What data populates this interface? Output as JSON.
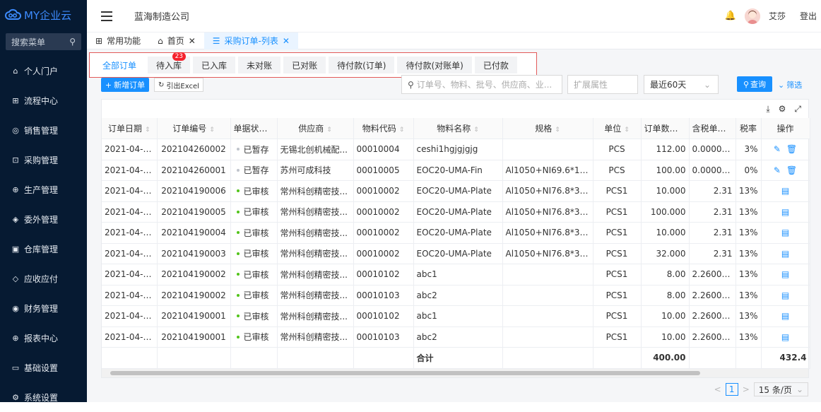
{
  "app": {
    "logo_text": "MY企业云"
  },
  "sidebar": {
    "search_label": "搜索菜单",
    "items": [
      {
        "label": "个人门户",
        "icon": "home-icon"
      },
      {
        "label": "流程中心",
        "icon": "flow-icon"
      },
      {
        "label": "销售管理",
        "icon": "sales-icon"
      },
      {
        "label": "采购管理",
        "icon": "cart-icon"
      },
      {
        "label": "生产管理",
        "icon": "production-icon"
      },
      {
        "label": "委外管理",
        "icon": "outsource-icon"
      },
      {
        "label": "仓库管理",
        "icon": "warehouse-icon"
      },
      {
        "label": "应收应付",
        "icon": "shield-icon"
      },
      {
        "label": "财务管理",
        "icon": "finance-icon"
      },
      {
        "label": "报表中心",
        "icon": "report-icon"
      },
      {
        "label": "基础设置",
        "icon": "folder-icon"
      },
      {
        "label": "系统设置",
        "icon": "gear-icon"
      }
    ]
  },
  "header": {
    "company": "蓝海制造公司",
    "user": "艾莎",
    "logout": "登出"
  },
  "tabs": [
    {
      "label": "常用功能",
      "closable": false
    },
    {
      "label": "首页",
      "closable": true
    },
    {
      "label": "采购订单-列表",
      "closable": true,
      "active": true
    }
  ],
  "status_tabs": [
    {
      "label": "全部订单",
      "active": true
    },
    {
      "label": "待入库",
      "badge": "23"
    },
    {
      "label": "已入库"
    },
    {
      "label": "未对账"
    },
    {
      "label": "已对账"
    },
    {
      "label": "待付款(订单)"
    },
    {
      "label": "待付款(对账单)"
    },
    {
      "label": "已付款"
    }
  ],
  "toolbar": {
    "new_label": "新增订单",
    "export_label": "引出Excel",
    "search_placeholder": "订单号、物料、批号、供应商、业...",
    "ext_placeholder": "扩展属性",
    "date_range": "最近60天",
    "query_label": "查询",
    "filter_label": "筛选"
  },
  "table": {
    "columns": [
      "订单日期",
      "订单编号",
      "单据状态",
      "供应商",
      "物料代码",
      "物料名称",
      "规格",
      "单位",
      "订单数量",
      "含税单价",
      "税率",
      "操作"
    ],
    "rows": [
      {
        "date": "2021-04-26",
        "no": "202104260002",
        "status": "已暂存",
        "status_kind": "draft",
        "supplier": "无锡北创机械配...",
        "code": "00010004",
        "name": "ceshi1hgjgjgjg",
        "spec": "",
        "unit": "PCS",
        "qty": "112.00",
        "price": "0.000000",
        "tax": "3%",
        "ops": "edit-delete"
      },
      {
        "date": "2021-04-26",
        "no": "202104260001",
        "status": "已暂存",
        "status_kind": "draft",
        "supplier": "苏州可成科技",
        "code": "00010005",
        "name": "EOC20-UMA-Fin",
        "spec": "Al1050+NI69.6*13.7*...",
        "unit": "PCS",
        "qty": "100.00",
        "price": "0.000000",
        "tax": "0%",
        "ops": "edit-delete"
      },
      {
        "date": "2021-04-19",
        "no": "202104190006",
        "status": "已审核",
        "status_kind": "approved",
        "supplier": "常州科创精密技...",
        "code": "00010002",
        "name": "EOC20-UMA-Plate",
        "spec": "Al1050+NI76.8*31.3*...",
        "unit": "PCS1",
        "qty": "10.000",
        "price": "2.31",
        "tax": "13%",
        "ops": "view"
      },
      {
        "date": "2021-04-19",
        "no": "202104190005",
        "status": "已审核",
        "status_kind": "approved",
        "supplier": "常州科创精密技...",
        "code": "00010002",
        "name": "EOC20-UMA-Plate",
        "spec": "Al1050+NI76.8*31.3*...",
        "unit": "PCS1",
        "qty": "100.000",
        "price": "2.31",
        "tax": "13%",
        "ops": "view"
      },
      {
        "date": "2021-04-19",
        "no": "202104190004",
        "status": "已审核",
        "status_kind": "approved",
        "supplier": "常州科创精密技...",
        "code": "00010002",
        "name": "EOC20-UMA-Plate",
        "spec": "Al1050+NI76.8*31.3*...",
        "unit": "PCS1",
        "qty": "10.000",
        "price": "2.31",
        "tax": "13%",
        "ops": "view"
      },
      {
        "date": "2021-04-19",
        "no": "202104190003",
        "status": "已审核",
        "status_kind": "approved",
        "supplier": "常州科创精密技...",
        "code": "00010002",
        "name": "EOC20-UMA-Plate",
        "spec": "Al1050+NI76.8*31.3*...",
        "unit": "PCS1",
        "qty": "32.000",
        "price": "2.31",
        "tax": "13%",
        "ops": "view"
      },
      {
        "date": "2021-04-19",
        "no": "202104190002",
        "status": "已审核",
        "status_kind": "approved",
        "supplier": "常州科创精密技...",
        "code": "00010102",
        "name": "abc1",
        "spec": "",
        "unit": "PCS1",
        "qty": "8.00",
        "price": "2.260000",
        "tax": "13%",
        "ops": "view"
      },
      {
        "date": "2021-04-19",
        "no": "202104190002",
        "status": "已审核",
        "status_kind": "approved",
        "supplier": "常州科创精密技...",
        "code": "00010103",
        "name": "abc2",
        "spec": "",
        "unit": "PCS1",
        "qty": "8.00",
        "price": "2.260000",
        "tax": "13%",
        "ops": "view"
      },
      {
        "date": "2021-04-19",
        "no": "202104190001",
        "status": "已审核",
        "status_kind": "approved",
        "supplier": "常州科创精密技...",
        "code": "00010102",
        "name": "abc1",
        "spec": "",
        "unit": "PCS1",
        "qty": "10.00",
        "price": "2.260000",
        "tax": "13%",
        "ops": "view"
      },
      {
        "date": "2021-04-19",
        "no": "202104190001",
        "status": "已审核",
        "status_kind": "approved",
        "supplier": "常州科创精密技...",
        "code": "00010103",
        "name": "abc2",
        "spec": "",
        "unit": "PCS1",
        "qty": "10.00",
        "price": "2.260000",
        "tax": "13%",
        "ops": "view"
      }
    ],
    "summary": {
      "label": "合计",
      "qty": "400.00",
      "amount": "432.4"
    }
  },
  "pager": {
    "current": "1",
    "page_size": "15 条/页"
  },
  "colors": {
    "sidebar": "#061a32",
    "accent": "#1890ff",
    "badge": "#f5222d",
    "highlight_border": "#e35a5a"
  }
}
